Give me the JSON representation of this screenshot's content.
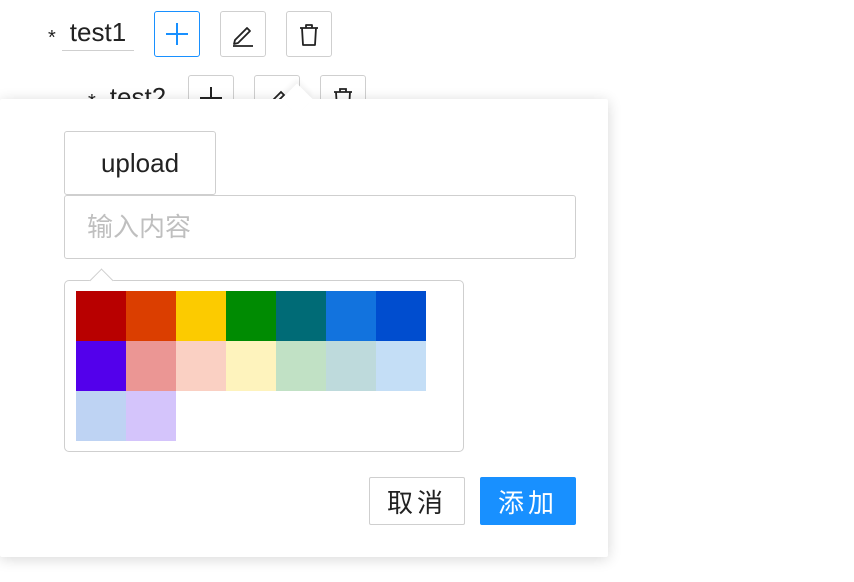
{
  "tree": {
    "nodes": [
      {
        "required_mark": "*",
        "label": "test1"
      },
      {
        "required_mark": "*",
        "label": "test2"
      }
    ]
  },
  "popover": {
    "upload_label": "upload",
    "input_placeholder": "输入内容",
    "input_value": "",
    "colors": [
      "#b80000",
      "#db3e00",
      "#fccb00",
      "#008b02",
      "#006b76",
      "#1273de",
      "#004dcf",
      "#5300eb",
      "#eb9694",
      "#fad0c3",
      "#fef3bd",
      "#c1e1c5",
      "#bedadc",
      "#c4def6",
      "#bed3f3",
      "#d4c4fb"
    ],
    "cancel_label": "取消",
    "add_label": "添加"
  },
  "theme": {
    "primary": "#1890ff",
    "border": "#cfcfcf"
  }
}
